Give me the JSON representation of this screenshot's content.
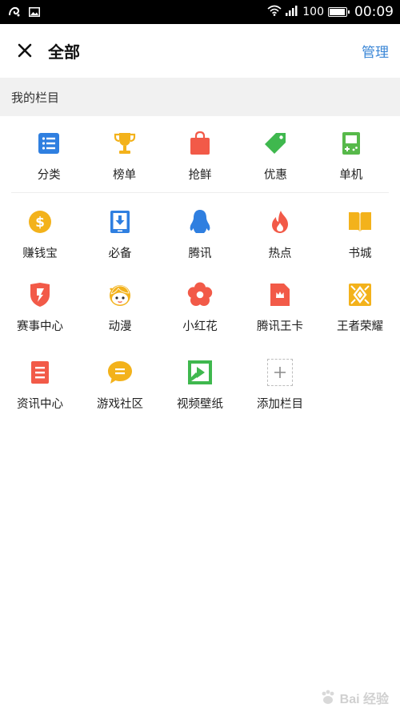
{
  "status_bar": {
    "battery_percent": "100",
    "time": "00:09",
    "battery_level": 1.0
  },
  "header": {
    "title": "全部",
    "manage_label": "管理"
  },
  "section": {
    "title": "我的栏目"
  },
  "rows": [
    [
      {
        "label": "分类",
        "icon": "list-icon",
        "color": "#2f7fe0"
      },
      {
        "label": "榜单",
        "icon": "trophy-icon",
        "color": "#f3b21b"
      },
      {
        "label": "抢鲜",
        "icon": "shopping-bag-icon",
        "color": "#f25a48"
      },
      {
        "label": "优惠",
        "icon": "price-tag-icon",
        "color": "#3fb84e"
      },
      {
        "label": "单机",
        "icon": "gameboy-icon",
        "color": "#57b94a"
      }
    ],
    [
      {
        "label": "赚钱宝",
        "icon": "coin-icon",
        "color": "#f3b21b"
      },
      {
        "label": "必备",
        "icon": "download-tablet-icon",
        "color": "#2f7fe0"
      },
      {
        "label": "腾讯",
        "icon": "penguin-icon",
        "color": "#2f7fe0"
      },
      {
        "label": "热点",
        "icon": "flame-icon",
        "color": "#f25a48"
      },
      {
        "label": "书城",
        "icon": "book-icon",
        "color": "#f3b21b"
      }
    ],
    [
      {
        "label": "赛事中心",
        "icon": "shield-bolt-icon",
        "color": "#f25a48"
      },
      {
        "label": "动漫",
        "icon": "anime-face-icon",
        "color": "#f3b21b"
      },
      {
        "label": "小红花",
        "icon": "flower-icon",
        "color": "#f25a48"
      },
      {
        "label": "腾讯王卡",
        "icon": "crown-card-icon",
        "color": "#f25a48"
      },
      {
        "label": "王者荣耀",
        "icon": "game-emblem-icon",
        "color": "#f3b21b"
      }
    ],
    [
      {
        "label": "资讯中心",
        "icon": "document-icon",
        "color": "#f25a48"
      },
      {
        "label": "游戏社区",
        "icon": "chat-bubble-icon",
        "color": "#f3b21b"
      },
      {
        "label": "视频壁纸",
        "icon": "video-play-icon",
        "color": "#3fb84e"
      },
      {
        "label": "添加栏目",
        "icon": "add-icon",
        "color": "#9e9e9e"
      }
    ]
  ],
  "watermark": {
    "text": "Bai 经验"
  }
}
